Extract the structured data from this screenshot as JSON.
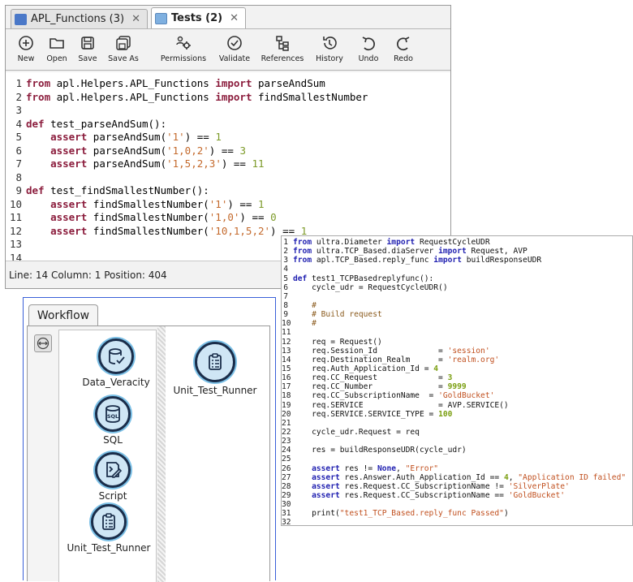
{
  "editor": {
    "tabs": [
      {
        "label": "APL_Functions (3)",
        "close": "✕"
      },
      {
        "label": "Tests (2)",
        "close": "✕"
      }
    ],
    "toolbar": {
      "new": "New",
      "open": "Open",
      "save": "Save",
      "save_as": "Save As",
      "permissions": "Permissions",
      "validate": "Validate",
      "references": "References",
      "history": "History",
      "undo": "Undo",
      "redo": "Redo"
    },
    "code_lines": [
      [
        {
          "t": "from",
          "c": "kw"
        },
        {
          "t": " apl.Helpers.APL_Functions "
        },
        {
          "t": "import",
          "c": "kw"
        },
        {
          "t": " parseAndSum"
        }
      ],
      [
        {
          "t": "from",
          "c": "kw"
        },
        {
          "t": " apl.Helpers.APL_Functions "
        },
        {
          "t": "import",
          "c": "kw"
        },
        {
          "t": " findSmallestNumber"
        }
      ],
      [],
      [
        {
          "t": "def",
          "c": "kw"
        },
        {
          "t": " test_parseAndSum():"
        }
      ],
      [
        {
          "t": "    "
        },
        {
          "t": "assert",
          "c": "kw"
        },
        {
          "t": " parseAndSum("
        },
        {
          "t": "'1'",
          "c": "st"
        },
        {
          "t": ") == "
        },
        {
          "t": "1",
          "c": "nm"
        }
      ],
      [
        {
          "t": "    "
        },
        {
          "t": "assert",
          "c": "kw"
        },
        {
          "t": " parseAndSum("
        },
        {
          "t": "'1,0,2'",
          "c": "st"
        },
        {
          "t": ") == "
        },
        {
          "t": "3",
          "c": "nm"
        }
      ],
      [
        {
          "t": "    "
        },
        {
          "t": "assert",
          "c": "kw"
        },
        {
          "t": " parseAndSum("
        },
        {
          "t": "'1,5,2,3'",
          "c": "st"
        },
        {
          "t": ") == "
        },
        {
          "t": "11",
          "c": "nm"
        }
      ],
      [],
      [
        {
          "t": "def",
          "c": "kw"
        },
        {
          "t": " test_findSmallestNumber():"
        }
      ],
      [
        {
          "t": "    "
        },
        {
          "t": "assert",
          "c": "kw"
        },
        {
          "t": " findSmallestNumber("
        },
        {
          "t": "'1'",
          "c": "st"
        },
        {
          "t": ") == "
        },
        {
          "t": "1",
          "c": "nm"
        }
      ],
      [
        {
          "t": "    "
        },
        {
          "t": "assert",
          "c": "kw"
        },
        {
          "t": " findSmallestNumber("
        },
        {
          "t": "'1,0'",
          "c": "st"
        },
        {
          "t": ") == "
        },
        {
          "t": "0",
          "c": "nm"
        }
      ],
      [
        {
          "t": "    "
        },
        {
          "t": "assert",
          "c": "kw"
        },
        {
          "t": " findSmallestNumber("
        },
        {
          "t": "'10,1,5,2'",
          "c": "st"
        },
        {
          "t": ") == "
        },
        {
          "t": "1",
          "c": "nm"
        }
      ],
      [],
      []
    ],
    "status": "Line: 14  Column: 1  Position: 404"
  },
  "workflow": {
    "tab_label": "Workflow",
    "palette": [
      {
        "label": "Data_Veracity",
        "icon": "data-veracity-icon"
      },
      {
        "label": "SQL",
        "icon": "sql-icon"
      },
      {
        "label": "Script",
        "icon": "script-icon"
      },
      {
        "label": "Unit_Test_Runner",
        "icon": "unit-test-runner-icon"
      }
    ],
    "canvas_node": {
      "label": "Unit_Test_Runner",
      "icon": "unit-test-runner-icon"
    }
  },
  "overlay_code": [
    [
      {
        "t": "from",
        "c": "k2"
      },
      {
        "t": " ultra.Diameter "
      },
      {
        "t": "import",
        "c": "k2"
      },
      {
        "t": " RequestCycleUDR"
      }
    ],
    [
      {
        "t": "from",
        "c": "k2"
      },
      {
        "t": " ultra.TCP_Based.diaServer "
      },
      {
        "t": "import",
        "c": "k2"
      },
      {
        "t": " Request, AVP"
      }
    ],
    [
      {
        "t": "from",
        "c": "k2"
      },
      {
        "t": " apl.TCP_Based.reply_func "
      },
      {
        "t": "import",
        "c": "k2"
      },
      {
        "t": " buildResponseUDR"
      }
    ],
    [],
    [
      {
        "t": "def",
        "c": "k2"
      },
      {
        "t": " test1_TCPBasedreplyfunc():"
      }
    ],
    [
      {
        "t": "    cycle_udr = RequestCycleUDR()"
      }
    ],
    [],
    [
      {
        "t": "    "
      },
      {
        "t": "#",
        "c": "c2"
      }
    ],
    [
      {
        "t": "    "
      },
      {
        "t": "# Build request",
        "c": "c2"
      }
    ],
    [
      {
        "t": "    "
      },
      {
        "t": "#",
        "c": "c2"
      }
    ],
    [],
    [
      {
        "t": "    req = Request()"
      }
    ],
    [
      {
        "t": "    req.Session_Id             = "
      },
      {
        "t": "'session'",
        "c": "s2"
      }
    ],
    [
      {
        "t": "    req.Destination_Realm      = "
      },
      {
        "t": "'realm.org'",
        "c": "s2"
      }
    ],
    [
      {
        "t": "    req.Auth_Application_Id = "
      },
      {
        "t": "4",
        "c": "n2"
      }
    ],
    [
      {
        "t": "    req.CC_Request             = "
      },
      {
        "t": "3",
        "c": "n2"
      }
    ],
    [
      {
        "t": "    req.CC_Number              = "
      },
      {
        "t": "9999",
        "c": "n2"
      }
    ],
    [
      {
        "t": "    req.CC_SubscriptionName  = "
      },
      {
        "t": "'GoldBucket'",
        "c": "s2"
      }
    ],
    [
      {
        "t": "    req.SERVICE                = AVP.SERVICE()"
      }
    ],
    [
      {
        "t": "    req.SERVICE.SERVICE_TYPE = "
      },
      {
        "t": "100",
        "c": "n2"
      }
    ],
    [],
    [
      {
        "t": "    cycle_udr.Request = req"
      }
    ],
    [],
    [
      {
        "t": "    res = buildResponseUDR(cycle_udr)"
      }
    ],
    [],
    [
      {
        "t": "    "
      },
      {
        "t": "assert",
        "c": "k2"
      },
      {
        "t": " res != "
      },
      {
        "t": "None",
        "c": "k2"
      },
      {
        "t": ", "
      },
      {
        "t": "\"Error\"",
        "c": "s2"
      }
    ],
    [
      {
        "t": "    "
      },
      {
        "t": "assert",
        "c": "k2"
      },
      {
        "t": " res.Answer.Auth_Application_Id == "
      },
      {
        "t": "4",
        "c": "n2"
      },
      {
        "t": ", "
      },
      {
        "t": "\"Application ID failed\"",
        "c": "s2"
      }
    ],
    [
      {
        "t": "    "
      },
      {
        "t": "assert",
        "c": "k2"
      },
      {
        "t": " res.Request.CC_SubscriptionName != "
      },
      {
        "t": "'SilverPlate'",
        "c": "s2"
      }
    ],
    [
      {
        "t": "    "
      },
      {
        "t": "assert",
        "c": "k2"
      },
      {
        "t": " res.Request.CC_SubscriptionName == "
      },
      {
        "t": "'GoldBucket'",
        "c": "s2"
      }
    ],
    [],
    [
      {
        "t": "    print("
      },
      {
        "t": "\"test1_TCP_Based.reply_func Passed\"",
        "c": "s2"
      },
      {
        "t": ")"
      }
    ],
    []
  ],
  "colors": {
    "keyword": "#8b1c3c",
    "string": "#c46a2d",
    "number": "#7d9b2a",
    "workflow_border": "#3a60d8"
  }
}
